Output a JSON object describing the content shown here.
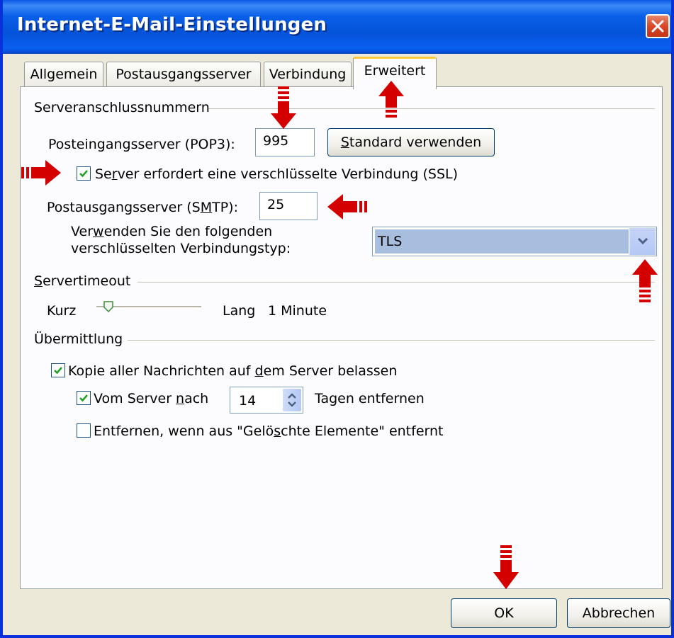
{
  "window": {
    "title": "Internet-E-Mail-Einstellungen"
  },
  "tabs": [
    {
      "label": "Allgemein"
    },
    {
      "label": "Postausgangsserver"
    },
    {
      "label": "Verbindung"
    },
    {
      "label": "Erweitert",
      "active": true
    }
  ],
  "server_ports": {
    "group_label": "Serveranschlussnummern",
    "incoming_label": "Posteingangsserver (POP3):",
    "incoming_value": "995",
    "default_button": "Standard verwenden",
    "ssl_checkbox_label": "Server erfordert eine verschlüsselte Verbindung (SSL)",
    "ssl_checked": true,
    "outgoing_label": "Postausgangsserver (SMTP):",
    "outgoing_value": "25",
    "encryption_label_line1": "Verwenden Sie den folgenden",
    "encryption_label_line2": "verschlüsselten Verbindungstyp:",
    "encryption_value": "TLS"
  },
  "timeout": {
    "group_label": "Servertimeout",
    "short_label": "Kurz",
    "long_label": "Lang",
    "value_label": "1 Minute",
    "slider_level": 0.07
  },
  "delivery": {
    "group_label": "Übermittlung",
    "keep_copy_label": "Kopie aller Nachrichten auf dem Server belassen",
    "keep_copy_checked": true,
    "remove_after_label": "Vom Server nach",
    "remove_after_checked": true,
    "days_value": "14",
    "days_suffix": "Tagen entfernen",
    "remove_deleted_label": "Entfernen, wenn aus \"Gelöschte Elemente\" entfernt",
    "remove_deleted_checked": false
  },
  "buttons": {
    "ok": "OK",
    "cancel": "Abbrechen"
  },
  "colors": {
    "annotation_arrow": "#d40000",
    "titlebar": "#0553d8",
    "dialog_bg": "#ece9d8"
  }
}
